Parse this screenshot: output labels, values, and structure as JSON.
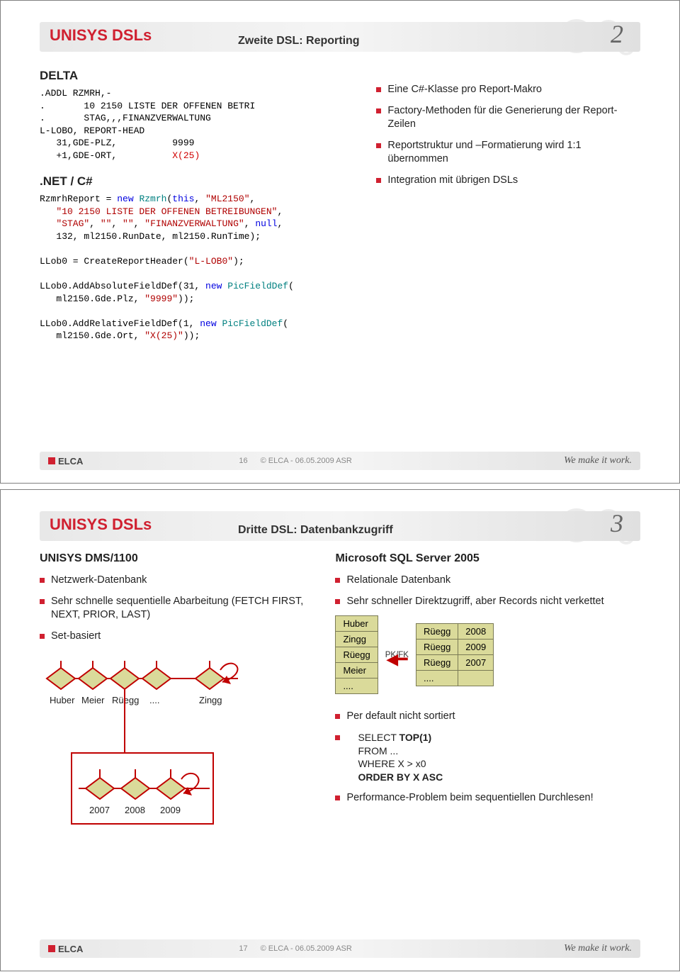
{
  "slide1": {
    "main_title": "UNISYS DSLs",
    "sub_title": "Zweite DSL: Reporting",
    "page_num_glyph": "2",
    "section_delta": "DELTA",
    "section_net": ".NET / C#",
    "delta_code_plain": ".ADDL RZMRH,-\n.       10 2150 LISTE DER OFFENEN BETRI\n.       STAG,,,FINANZVERWALTUNG\nL-LOBO, REPORT-HEAD\n   31,GDE-PLZ,          9999\n   +1,GDE-ORT,          ",
    "delta_code_red": "X(25)",
    "net_code": "RzmrhReport = new Rzmrh(this, \"ML2150\",\n   \"10 2150 LISTE DER OFFENEN BETREIBUNGEN\",\n   \"STAG\", \"\", \"\", \"FINANZVERWALTUNG\", null,\n   132, ml2150.RunDate, ml2150.RunTime);\n\nLLob0 = CreateReportHeader(\"L-LOB0\");\n\nLLob0.AddAbsoluteFieldDef(31, new PicFieldDef(\n   ml2150.Gde.Plz, \"9999\"));\n\nLLob0.AddRelativeFieldDef(1, new PicFieldDef(\n   ml2150.Gde.Ort, \"X(25)\"));",
    "bullets": [
      "Eine C#-Klasse pro Report-Makro",
      "Factory-Methoden für die Generierung der Report-Zeilen",
      "Reportstruktur und –Formatierung wird 1:1 übernommen",
      "Integration mit übrigen DSLs"
    ],
    "footer": {
      "elca": "ELCA",
      "page": "16",
      "copy": "© ELCA - 06.05.2009  ASR",
      "tagline": "We make it work."
    }
  },
  "slide2": {
    "main_title": "UNISYS DSLs",
    "sub_title": "Dritte DSL: Datenbankzugriff",
    "page_num_glyph": "3",
    "left_hdr": "UNISYS DMS/1100",
    "right_hdr": "Microsoft SQL Server 2005",
    "left_bullets": [
      "Netzwerk-Datenbank",
      "Sehr schnelle sequentielle Abarbeitung (FETCH FIRST, NEXT, PRIOR, LAST)",
      "Set-basiert"
    ],
    "set_names": [
      "Huber",
      "Meier",
      "Rüegg",
      "....",
      "Zingg"
    ],
    "set_years": [
      "2007",
      "2008",
      "2009"
    ],
    "right_bullets_top": [
      "Relationale Datenbank",
      "Sehr schneller Direktzugriff, aber Records nicht verkettet"
    ],
    "table1": [
      "Huber",
      "Zingg",
      "Rüegg",
      "Meier",
      "...."
    ],
    "pkfk": "PK/FK",
    "table2": [
      [
        "Rüegg",
        "2008"
      ],
      [
        "Rüegg",
        "2009"
      ],
      [
        "Rüegg",
        "2007"
      ],
      [
        "....",
        ""
      ]
    ],
    "right_bullets_bottom": [
      "Per default nicht sortiert",
      "SELECT TOP(1) FROM ... WHERE X > x0 ORDER BY X ASC",
      "Performance-Problem beim sequentiellen Durchlesen!"
    ],
    "sql_lines": {
      "l1a": "SELECT ",
      "l1b": "TOP(1)",
      "l2": "FROM ...",
      "l3a": "WHERE X > x0",
      "l4": "ORDER BY X ASC"
    },
    "footer": {
      "elca": "ELCA",
      "page": "17",
      "copy": "© ELCA - 06.05.2009  ASR",
      "tagline": "We make it work."
    }
  }
}
